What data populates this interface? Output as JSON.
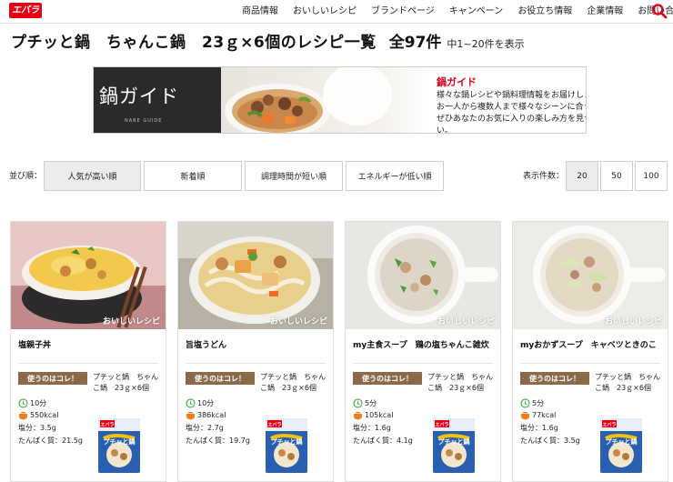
{
  "header": {
    "logo": "エバラ",
    "nav": [
      "商品情報",
      "おいしいレシピ",
      "ブランドページ",
      "キャンペーン",
      "お役立ち情報",
      "企業情報",
      "お問い合わせ"
    ]
  },
  "page": {
    "title": "プチッと鍋　ちゃんこ鍋　23ｇ×6個のレシピ一覧",
    "total": "全97件",
    "range": "中1~20件を表示"
  },
  "banner": {
    "jp_title": "鍋ガイド",
    "en_title": "NABE GUIDE",
    "heading": "鍋ガイド",
    "lines": [
      "様々な鍋レシピや鍋料理情報をお届けします。",
      "お一人から複数人まで様々なシーンに合う鍋料理。",
      "ぜひあなたのお気に入りの楽しみ方を見つけてください。"
    ],
    "arrow": "›"
  },
  "sort": {
    "label": "並び順：",
    "options": [
      "人気が高い順",
      "新着順",
      "調理時間が短い順",
      "エネルギーが低い順"
    ],
    "selected": "人気が高い順"
  },
  "display_count": {
    "label": "表示件数：",
    "options": [
      "20",
      "50",
      "100"
    ],
    "selected": "20"
  },
  "card_common": {
    "watermark": "おいしいレシピ",
    "use_label": "使うのはコレ！",
    "product_name": "プチッと鍋　ちゃんこ鍋　23ｇ×6個",
    "product_brand": "エバラ",
    "product_label": "プチッと鍋",
    "salt_prefix": "塩分：",
    "protein_prefix": "たんぱく質："
  },
  "recipes": [
    {
      "title": "塩親子丼",
      "time": "10分",
      "energy": "550kcal",
      "salt": "3.5g",
      "protein": "21.5g"
    },
    {
      "title": "旨塩うどん",
      "time": "10分",
      "energy": "386kcal",
      "salt": "2.7g",
      "protein": "19.7g"
    },
    {
      "title": "my主食スープ　鶏の塩ちゃんこ雑炊",
      "time": "5分",
      "energy": "105kcal",
      "salt": "1.6g",
      "protein": "4.1g"
    },
    {
      "title": "myおかずスープ　キャベツときのこ",
      "time": "5分",
      "energy": "77kcal",
      "salt": "1.6g",
      "protein": "3.5g"
    }
  ],
  "colors": {
    "brand_red": "#e60012",
    "badge_brown": "#8b6a4a",
    "active_button": "#ececec"
  }
}
